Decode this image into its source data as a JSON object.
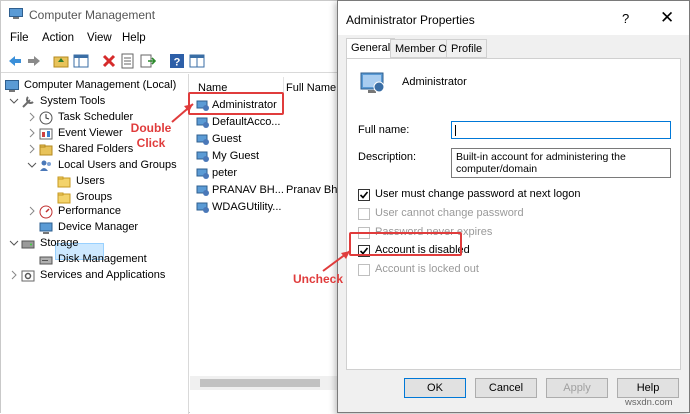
{
  "window": {
    "title": "Computer Management"
  },
  "menu": [
    "File",
    "Action",
    "View",
    "Help"
  ],
  "tree": [
    {
      "label": "Computer Management (Local)",
      "icon": "computer-management-icon"
    },
    {
      "label": "System Tools",
      "icon": "system-tools-icon"
    },
    {
      "label": "Task Scheduler",
      "icon": "clock-icon"
    },
    {
      "label": "Event Viewer",
      "icon": "event-viewer-icon"
    },
    {
      "label": "Shared Folders",
      "icon": "shared-folder-icon"
    },
    {
      "label": "Local Users and Groups",
      "icon": "users-icon"
    },
    {
      "label": "Users",
      "icon": "folder-icon"
    },
    {
      "label": "Groups",
      "icon": "folder-icon"
    },
    {
      "label": "Performance",
      "icon": "performance-icon"
    },
    {
      "label": "Device Manager",
      "icon": "device-manager-icon"
    },
    {
      "label": "Storage",
      "icon": "storage-icon"
    },
    {
      "label": "Disk Management",
      "icon": "disk-icon"
    },
    {
      "label": "Services and Applications",
      "icon": "services-icon"
    }
  ],
  "list": {
    "columns": [
      "Name",
      "Full Name"
    ],
    "rows": [
      {
        "name": "Administrator",
        "full_name": ""
      },
      {
        "name": "DefaultAcco...",
        "full_name": ""
      },
      {
        "name": "Guest",
        "full_name": ""
      },
      {
        "name": "My Guest",
        "full_name": ""
      },
      {
        "name": "peter",
        "full_name": ""
      },
      {
        "name": "PRANAV BH...",
        "full_name": "Pranav Bha"
      },
      {
        "name": "WDAGUtility...",
        "full_name": ""
      }
    ]
  },
  "dialog": {
    "title": "Administrator Properties",
    "help_glyph": "?",
    "close_glyph": "✕",
    "tabs": [
      "General",
      "Member Of",
      "Profile"
    ],
    "user_name": "Administrator",
    "full_name_label": "Full name:",
    "full_name_value": "",
    "description_label": "Description:",
    "description_value": "Built-in account for administering the computer/domain",
    "checkboxes": [
      {
        "label": "User must change password at next logon",
        "checked": true,
        "enabled": true
      },
      {
        "label": "User cannot change password",
        "checked": false,
        "enabled": false
      },
      {
        "label": "Password never expires",
        "checked": false,
        "enabled": false
      },
      {
        "label": "Account is disabled",
        "checked": true,
        "enabled": true
      },
      {
        "label": "Account is locked out",
        "checked": false,
        "enabled": false
      }
    ],
    "buttons": {
      "ok": "OK",
      "cancel": "Cancel",
      "apply": "Apply",
      "help": "Help"
    }
  },
  "annotations": {
    "double_click_line1": "Double",
    "double_click_line2": "Click",
    "uncheck": "Uncheck",
    "color": "#e03c3c"
  },
  "watermark": "wsxdn.com"
}
